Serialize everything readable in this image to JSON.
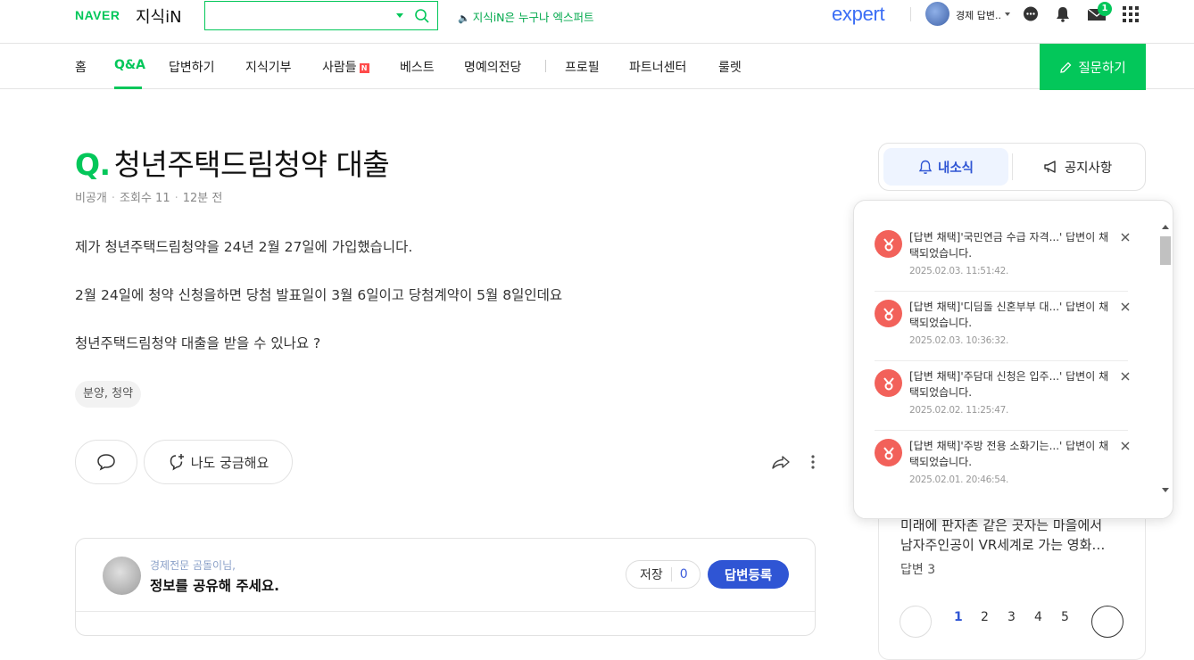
{
  "header": {
    "naver_logo": "NAVER",
    "jisik_logo": "지식iN",
    "search_value": "",
    "promo_text": "지식iN은 누구나 엑스퍼트",
    "expert_logo": "expert",
    "user_name": "경제 답변..",
    "message_badge": "1"
  },
  "nav": {
    "items": [
      "홈",
      "Q&A",
      "답변하기",
      "지식기부",
      "사람들",
      "베스트",
      "명예의전당",
      "프로필",
      "파트너센터",
      "룰렛"
    ],
    "new_badge": "N",
    "ask_button": "질문하기"
  },
  "question": {
    "q_mark": "Q.",
    "title": "청년주택드림청약 대출",
    "meta": [
      "비공개",
      "조회수 11",
      "12분 전"
    ],
    "body": [
      "제가 청년주택드림청약을 24년 2월 27일에 가입했습니다.",
      "2월 24일에 청약 신청을하면 당첨 발표일이 3월 6일이고 당첨계약이 5월 8일인데요",
      "청년주택드림청약 대출을 받을 수 있나요 ?"
    ],
    "tag": "분양, 청약",
    "curious_button": "나도 궁금해요"
  },
  "answer_card": {
    "subtitle": "경제전문 곰돌이님,",
    "prompt": "정보를 공유해 주세요.",
    "save_label": "저장",
    "save_count": "0",
    "register_button": "답변등록"
  },
  "right_panel": {
    "tab_news": "내소식",
    "tab_notice": "공지사항",
    "behind_text_1": "미래에 판자촌 같은 곳자는 마을에서",
    "behind_text_2": "남자주인공이 VR세계로 가는 영화…",
    "answers_count": "답변 3",
    "pages": [
      "1",
      "2",
      "3",
      "4",
      "5"
    ]
  },
  "notifications": [
    {
      "message": "[답변 채택]'국민연금 수급 자격...' 답변이 채택되었습니다.",
      "time": "2025.02.03. 11:51:42."
    },
    {
      "message": "[답변 채택]'디딤돌 신혼부부 대...' 답변이 채택되었습니다.",
      "time": "2025.02.03. 10:36:32."
    },
    {
      "message": "[답변 채택]'주담대 신청은 입주...' 답변이 채택되었습니다.",
      "time": "2025.02.02. 11:25:47."
    },
    {
      "message": "[답변 채택]'주방 전용 소화기는...' 답변이 채택되었습니다.",
      "time": "2025.02.01. 20:46:54."
    }
  ],
  "colors": {
    "brand_green": "#03c75a",
    "accent_blue": "#2f55d4",
    "notif_icon": "#f2615a"
  }
}
